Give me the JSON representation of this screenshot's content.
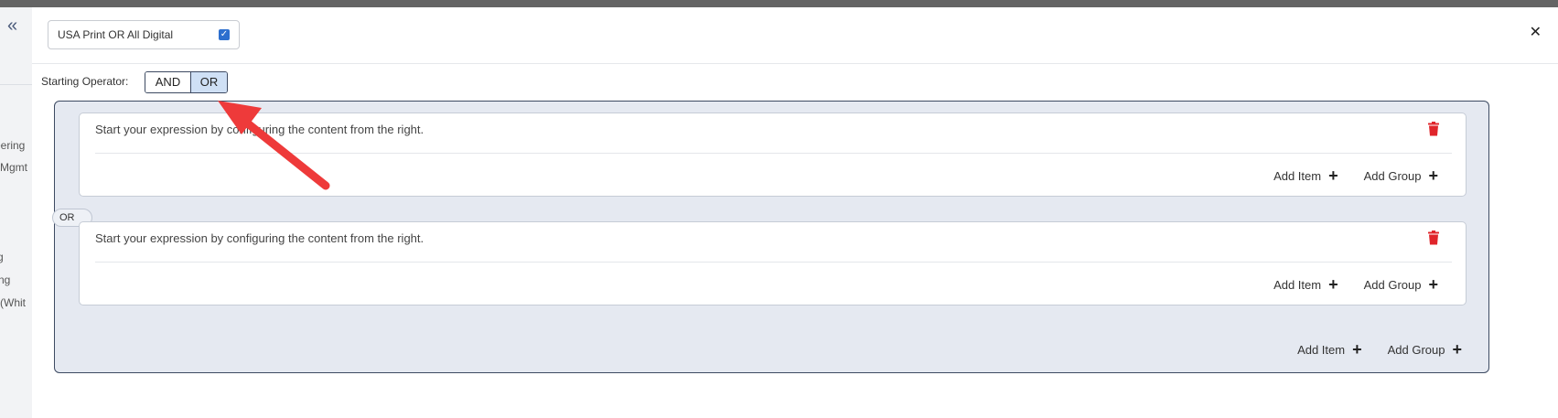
{
  "sidebar": {
    "collapse_icon": "double-chevron-left-icon",
    "fragments": [
      "eering",
      "Mgmt",
      "g",
      "ng",
      "(Whit"
    ]
  },
  "filter": {
    "name": "USA Print OR All Digital",
    "checked": true
  },
  "close_icon": "close-icon",
  "operator": {
    "label": "Starting Operator:",
    "options": [
      "AND",
      "OR"
    ],
    "selected": "OR"
  },
  "groups": [
    {
      "message": "Start your expression by configuring the content from the right.",
      "add_item": "Add Item",
      "add_group": "Add Group"
    },
    {
      "message": "Start your expression by configuring the content from the right.",
      "add_item": "Add Item",
      "add_group": "Add Group"
    }
  ],
  "connector": "OR",
  "outer_actions": {
    "add_item": "Add Item",
    "add_group": "Add Group"
  },
  "colors": {
    "accent": "#2d6fce",
    "selected_toggle": "#cfe0f5",
    "delete": "#e0252b",
    "annotation_arrow": "#ee3a3a"
  }
}
